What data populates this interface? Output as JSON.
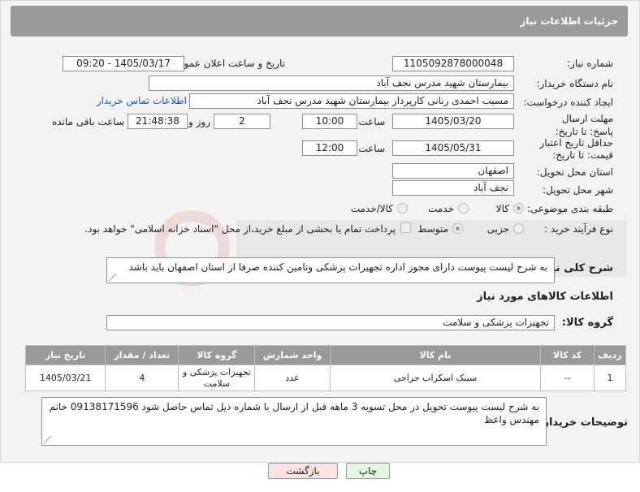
{
  "header": {
    "title": "جزئیات اطلاعات نیاز"
  },
  "form": {
    "need_number": {
      "label": "شماره نیاز:",
      "value": "1105092878000048"
    },
    "announce_datetime": {
      "label": "تاریخ و ساعت اعلان عمومی:",
      "value": "1405/03/17 - 09:20"
    },
    "buyer_org": {
      "label": "نام دستگاه خریدار:",
      "value": "بیمارستان شهید مدرس نجف آباد"
    },
    "requester": {
      "label": "ایجاد کننده درخواست:",
      "value": "مسیب احمدی رنانی کارپرداز بیمارستان شهید مدرس نجف آباد",
      "contact_link": "اطلاعات تماس خریدار"
    },
    "reply_deadline": {
      "label": "مهلت ارسال پاسخ: تا تاریخ:",
      "date": "1405/03/20",
      "time_label": "ساعت",
      "time": "10:00",
      "days": "2",
      "days_label": "روز و",
      "remaining_time": "21:48:38",
      "remaining_label": "ساعت باقی مانده"
    },
    "price_validity": {
      "label": "حداقل تاریخ اعتبار قیمت: تا تاریخ:",
      "date": "1405/05/31",
      "time_label": "ساعت",
      "time": "12:00"
    },
    "delivery_province": {
      "label": "استان محل تحویل:",
      "value": "اصفهان"
    },
    "delivery_city": {
      "label": "شهر محل تحویل:",
      "value": "نجف آباد"
    },
    "category": {
      "label": "طبقه بندی موضوعی:",
      "options": [
        "کالا",
        "خدمت",
        "کالا/خدمت"
      ],
      "selected": "کالا"
    },
    "process_type": {
      "label": "نوع فرآیند خرید :",
      "options": [
        "جزیی",
        "متوسط"
      ],
      "selected": "متوسط",
      "payment_note": "پرداخت تمام یا بخشی از مبلغ خرید،از محل \"اسناد خزانه اسلامی\" خواهد بود."
    },
    "general_description": {
      "label": "شرح کلی نیاز:",
      "value": "به شرح لیست پیوست  دارای مجوز اداره تجهیزات پزشکی وتامین کننده صرفا از استان اصفهان باید باشد"
    }
  },
  "goods": {
    "section_title": "اطلاعات کالاهای مورد نیاز",
    "group_label": "گروه کالا:",
    "group_value": "تجهیزات پزشکی و سلامت",
    "table": {
      "headers": [
        "ردیف",
        "کد کالا",
        "نام کالا",
        "واحد شمارش",
        "گروه کالا",
        "تعداد / مقدار",
        "تاریخ نیاز"
      ],
      "rows": [
        [
          "1",
          "--",
          "سینک اسکراب جراحی",
          "عدد",
          "تجهیزات پزشکی و سلامت",
          "4",
          "1405/03/21"
        ]
      ]
    }
  },
  "buyer_notes": {
    "label": "توضیحات خریدار:",
    "value": "به شرح لیست پیوست  تحویل در محل تسویه 3 ماهه قبل از ارسال با شماره ذیل تماس حاصل شود 09138171596 خانم مهندس واعظ"
  },
  "buttons": {
    "print": "چاپ",
    "back": "بازگشت"
  },
  "colors": {
    "header_bg": "#9a9a9a",
    "link": "#1a56c8",
    "back_button_bg": "#fbe3e3",
    "print_button_bg": "#e4f5e0"
  }
}
